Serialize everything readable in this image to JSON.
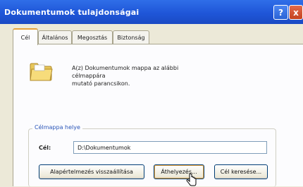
{
  "window": {
    "title": "Dokumentumok tulajdonságai",
    "help_label": "?",
    "close_label": "x"
  },
  "tabs": [
    {
      "label": "Cél",
      "active": true
    },
    {
      "label": "Általános",
      "active": false
    },
    {
      "label": "Megosztás",
      "active": false
    },
    {
      "label": "Biztonság",
      "active": false
    }
  ],
  "main": {
    "description_line1": "A(z) Dokumentumok mappa az alábbi célmappára",
    "description_line2": "mutató parancsikon.",
    "group_title": "Célmappa helye",
    "target_label": "Cél:",
    "target_value": "D:\\Dokumentumok",
    "buttons": {
      "restore_default": "Alapértelmezés visszaállítása",
      "move": "Áthelyezés...",
      "find_target": "Cél keresése..."
    }
  },
  "icons": {
    "folder": "folder-icon",
    "cursor": "mouse-pointer-icon"
  }
}
